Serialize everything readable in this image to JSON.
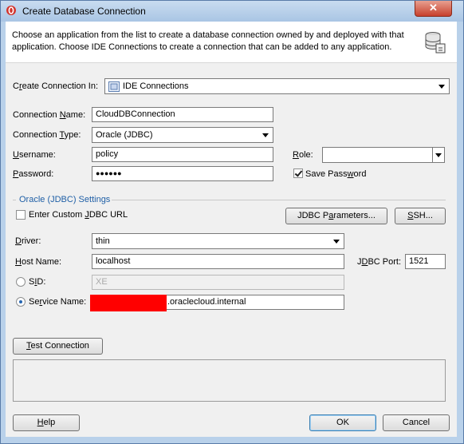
{
  "window": {
    "title": "Create Database Connection",
    "close_glyph": "✕"
  },
  "banner": {
    "text": "Choose an application from the list to create a database connection owned by and deployed with that application. Choose IDE Connections to create a connection that can be added to any application."
  },
  "form": {
    "create_connection_in": {
      "label_pre": "C",
      "label_mid": "r",
      "label_post": "eate Connection In:",
      "value": "IDE Connections"
    },
    "connection_name": {
      "label_pre": "Connection ",
      "label_mid": "N",
      "label_post": "ame:",
      "value": "CloudDBConnection"
    },
    "connection_type": {
      "label_pre": "Connection ",
      "label_mid": "T",
      "label_post": "ype:",
      "value": "Oracle (JDBC)"
    },
    "username": {
      "label_pre": "",
      "label_mid": "U",
      "label_post": "sername:",
      "value": "policy"
    },
    "password": {
      "label_pre": "",
      "label_mid": "P",
      "label_post": "assword:",
      "value": "●●●●●●"
    },
    "role": {
      "label_pre": "",
      "label_mid": "R",
      "label_post": "ole:",
      "value": ""
    },
    "save_password": {
      "label_pre": "Save Pass",
      "label_mid": "w",
      "label_post": "ord",
      "checked": true
    }
  },
  "jdbc_section": {
    "title": "Oracle (JDBC) Settings",
    "custom_url": {
      "label_pre": "Enter Custom ",
      "label_mid": "J",
      "label_post": "DBC URL",
      "checked": false
    },
    "jdbc_params_button": {
      "label_pre": "JDBC P",
      "label_mid": "a",
      "label_post": "rameters..."
    },
    "ssh_button": {
      "label_pre": "",
      "label_mid": "S",
      "label_post": "SH..."
    },
    "driver": {
      "label_pre": "",
      "label_mid": "D",
      "label_post": "river:",
      "value": "thin"
    },
    "host_name": {
      "label_pre": "",
      "label_mid": "H",
      "label_post": "ost Name:",
      "value": "localhost"
    },
    "jdbc_port": {
      "label_pre": "J",
      "label_mid": "D",
      "label_post": "BC Port:",
      "value": "1521"
    },
    "sid": {
      "label_pre": "S",
      "label_mid": "I",
      "label_post": "D:",
      "value": "XE",
      "selected": false
    },
    "service_name": {
      "label_pre": "Se",
      "label_mid": "r",
      "label_post": "vice Name:",
      "value_suffix": ".oraclecloud.internal",
      "selected": true
    }
  },
  "buttons": {
    "test_connection": {
      "label_pre": "",
      "label_mid": "T",
      "label_post": "est Connection"
    },
    "help": {
      "label_pre": "",
      "label_mid": "H",
      "label_post": "elp"
    },
    "ok": "OK",
    "cancel": "Cancel"
  },
  "colors": {
    "section_title": "#1f5fa6",
    "redaction": "#ff0000",
    "title_bar": "#b9d1ea"
  }
}
